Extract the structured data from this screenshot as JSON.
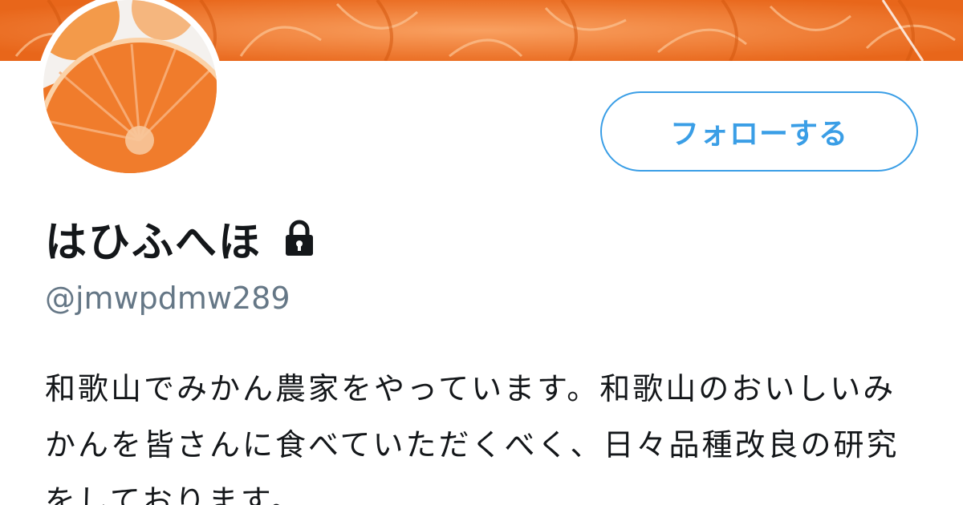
{
  "profile": {
    "display_name": "はひふへほ",
    "handle": "@jmwpdmw289",
    "bio": "和歌山でみかん農家をやっています。和歌山のおいしいみかんを皆さんに食べていただくべく、日々品種改良の研究をしております。",
    "protected_icon": "lock-icon"
  },
  "actions": {
    "follow_label": "フォローする"
  },
  "colors": {
    "accent": "#3a9ee6",
    "banner_orange": "#f07a2a",
    "name_text": "#14171a",
    "handle_text": "#657786"
  }
}
